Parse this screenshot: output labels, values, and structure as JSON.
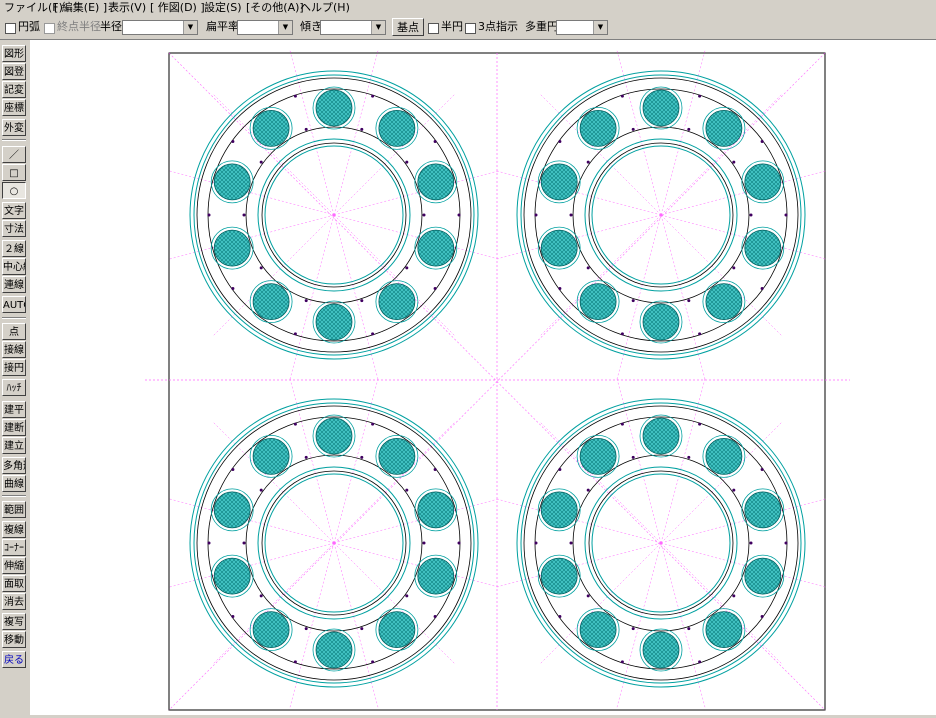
{
  "menubar": {
    "items": [
      "ファイル(F)",
      "[ 編集(E) ]",
      "表示(V)",
      "[ 作図(D) ]",
      "設定(S)",
      "[その他(A)]",
      "ヘルプ(H)"
    ]
  },
  "toolbar": {
    "arc_label": "円弧",
    "endpoint_radius_label": "終点半径",
    "radius_label": "半径",
    "radius_value": "",
    "flatness_label": "扁平率",
    "flatness_value": "",
    "tilt_label": "傾き",
    "tilt_value": "",
    "base_point_label": "基点",
    "semicircle_label": "半円",
    "three_point_label": "3点指示",
    "multi_circle_label": "多重円",
    "multi_circle_value": ""
  },
  "leftbar": {
    "items": [
      "図形",
      "図登",
      "記変",
      "座標",
      "外変",
      "／",
      "□",
      "○",
      "文字",
      "寸法",
      "２線",
      "中心線",
      "連線",
      "AUTO",
      "点",
      "接線",
      "接円",
      "ﾊｯﾁ",
      "建平",
      "建断",
      "建立",
      "多角形",
      "曲線",
      "範囲",
      "複線",
      "ｺｰﾅｰ",
      "伸縮",
      "面取",
      "消去",
      "複写",
      "移動",
      "戻る"
    ]
  },
  "colors": {
    "cyan": "#00a0a0",
    "ball_fill": "#40c0c0",
    "guide": "#ff66ff",
    "hatch": "#007070"
  }
}
